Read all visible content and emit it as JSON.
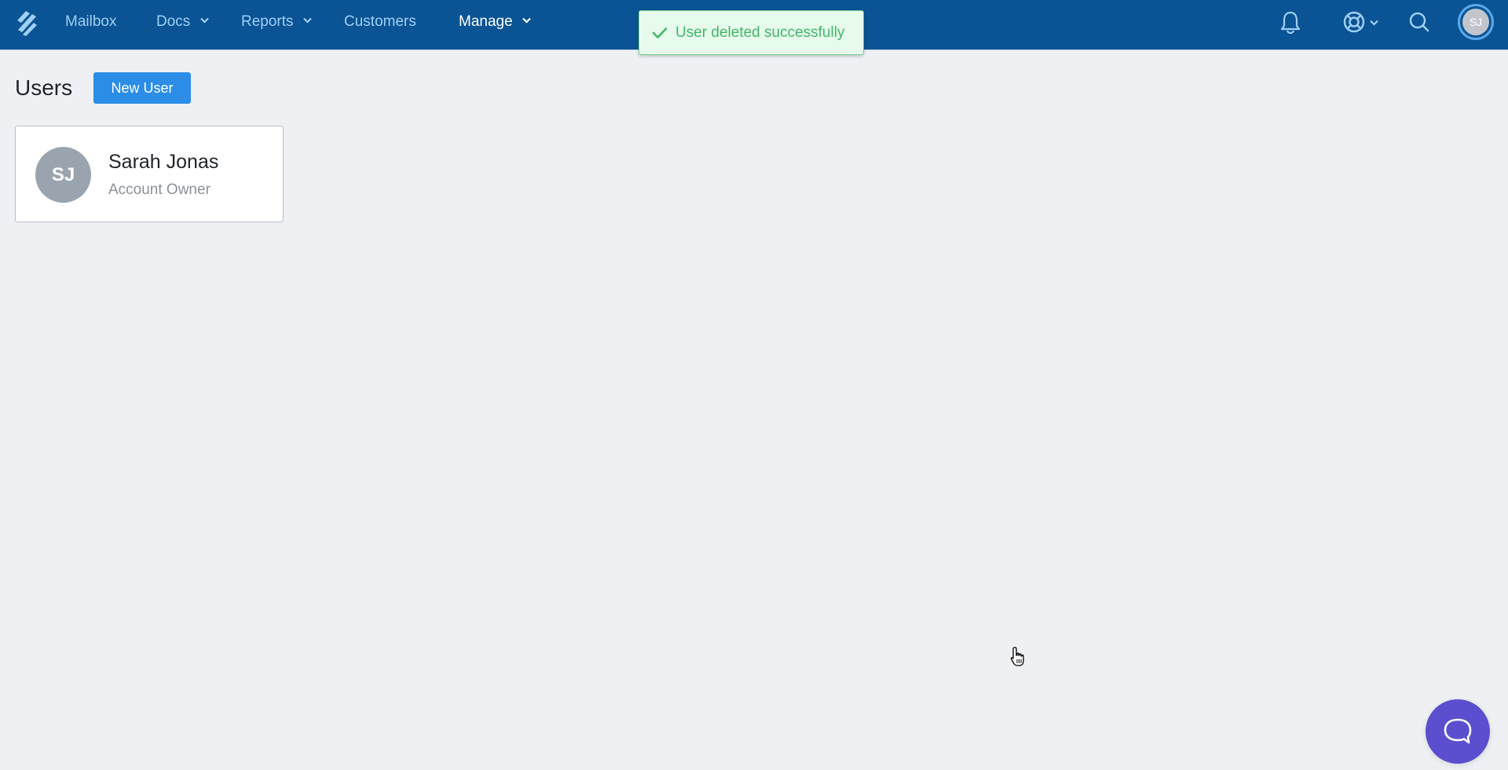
{
  "nav": {
    "items": [
      {
        "label": "Mailbox",
        "has_dropdown": false,
        "active": false
      },
      {
        "label": "Docs",
        "has_dropdown": true,
        "active": false
      },
      {
        "label": "Reports",
        "has_dropdown": true,
        "active": false
      },
      {
        "label": "Customers",
        "has_dropdown": false,
        "active": false
      },
      {
        "label": "Manage",
        "has_dropdown": true,
        "active": true
      }
    ],
    "icons": [
      "logo-icon",
      "bell-icon",
      "help-lifebuoy-icon",
      "search-icon"
    ],
    "user_initials": "SJ"
  },
  "toast": {
    "message": "User deleted successfully",
    "icon": "check-icon",
    "color": "#43b56a"
  },
  "page": {
    "title": "Users",
    "new_user_label": "New User"
  },
  "users": [
    {
      "initials": "SJ",
      "name": "Sarah Jonas",
      "role": "Account Owner"
    }
  ],
  "colors": {
    "nav_bg": "#0a5394",
    "accent": "#2b8de6",
    "chat": "#5b4fd0"
  },
  "chat": {
    "icon": "chat-bubble-icon"
  }
}
